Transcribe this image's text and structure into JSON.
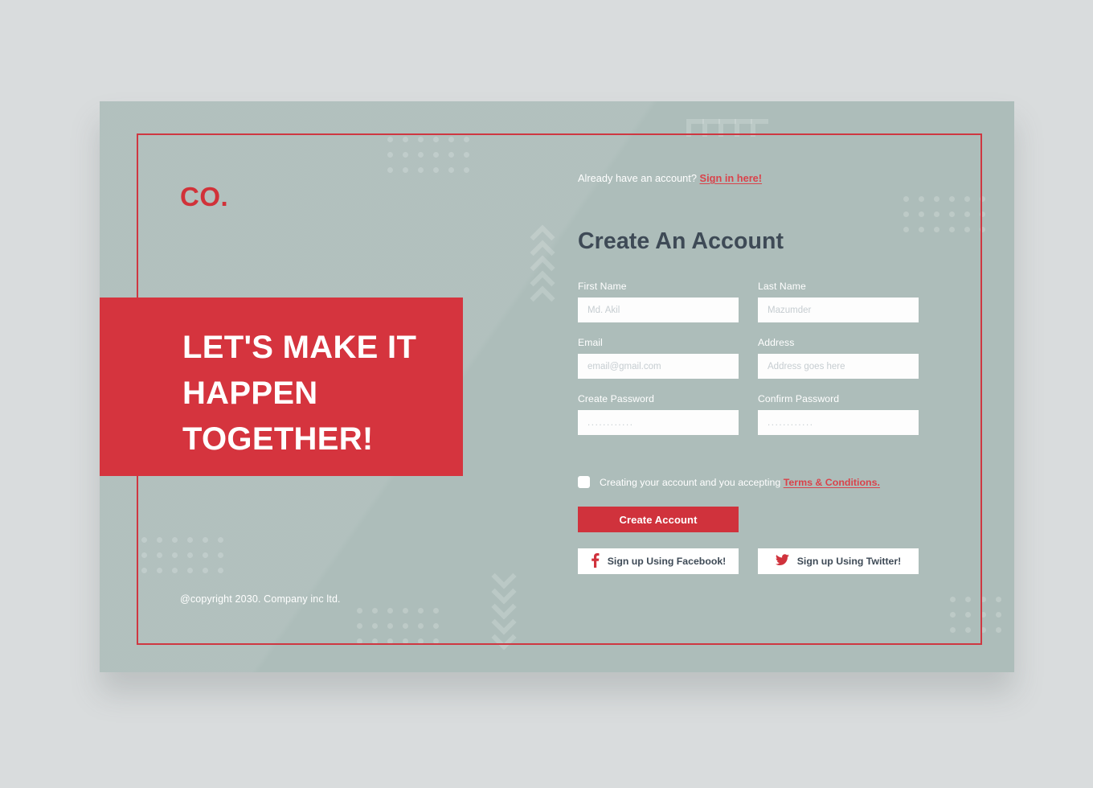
{
  "brand": {
    "logo": "CO.",
    "accent_red": "#d5343e",
    "card_bg": "#adbdba",
    "page_bg": "#d9dcdd",
    "heading_color": "#3e4a56"
  },
  "hero": {
    "headline": "LET'S MAKE IT HAPPEN TOGETHER!",
    "copyright": "@copyright 2030. Company inc ltd."
  },
  "signin": {
    "prompt": "Already have an account?",
    "link_label": "Sign in here!"
  },
  "form": {
    "title": "Create An Account",
    "fields": [
      {
        "label": "First Name",
        "placeholder": "Md. Akil",
        "value": "",
        "type": "text"
      },
      {
        "label": "Last Name",
        "placeholder": "Mazumder",
        "value": "",
        "type": "text"
      },
      {
        "label": "Email",
        "placeholder": "email@gmail.com",
        "value": "",
        "type": "text"
      },
      {
        "label": "Address",
        "placeholder": "Address goes here",
        "value": "",
        "type": "text"
      },
      {
        "label": "Create Password",
        "placeholder": "............",
        "value": "",
        "type": "password"
      },
      {
        "label": "Confirm Password",
        "placeholder": "............",
        "value": "",
        "type": "password"
      }
    ],
    "terms": {
      "text": "Creating your account and you accepting",
      "link_label": "Terms & Conditions.",
      "checked": false
    },
    "submit_label": "Create Account",
    "social": [
      {
        "label": "Sign up Using Facebook!",
        "icon": "facebook-icon"
      },
      {
        "label": "Sign up Using Twitter!",
        "icon": "twitter-icon"
      }
    ]
  }
}
